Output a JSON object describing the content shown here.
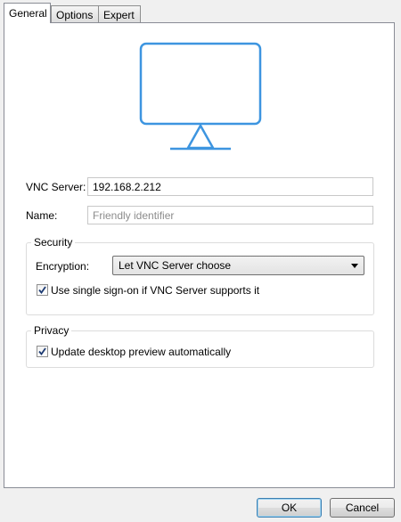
{
  "tabs": [
    {
      "label": "General",
      "active": true
    },
    {
      "label": "Options",
      "active": false
    },
    {
      "label": "Expert",
      "active": false
    }
  ],
  "preview": {
    "icon": "monitor-icon",
    "color": "#3d95e0"
  },
  "vnc_server": {
    "label": "VNC Server:",
    "value": "192.168.2.212"
  },
  "name": {
    "label": "Name:",
    "placeholder": "Friendly identifier"
  },
  "security": {
    "title": "Security",
    "encryption_label": "Encryption:",
    "encryption_value": "Let VNC Server choose",
    "sso_label": "Use single sign-on if VNC Server supports it",
    "sso_checked": true
  },
  "privacy": {
    "title": "Privacy",
    "preview_label": "Update desktop preview automatically",
    "preview_checked": true
  },
  "buttons": {
    "ok": "OK",
    "cancel": "Cancel"
  }
}
